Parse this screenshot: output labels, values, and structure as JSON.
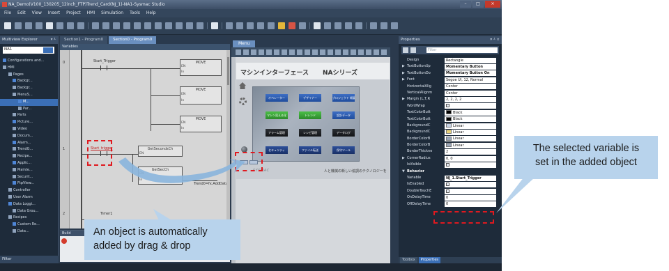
{
  "window": {
    "title": "NA_Demo(V100_130205_12inch_FTP)Trend_Card(NJ_1)-NA1-Sysmac Studio"
  },
  "menubar": [
    "File",
    "Edit",
    "View",
    "Insert",
    "Project",
    "HMI",
    "Simulation",
    "Tools",
    "Help"
  ],
  "explorer": {
    "title": "Multiview Explorer",
    "device": "NA1",
    "items": [
      {
        "label": "Configurations and...",
        "sel": false
      },
      {
        "label": "HMI",
        "sel": false
      },
      {
        "label": "Pages",
        "sel": false
      },
      {
        "label": "Backgr...",
        "sel": false
      },
      {
        "label": "Backgr...",
        "sel": false
      },
      {
        "label": "MenuS...",
        "sel": false
      },
      {
        "label": "M...",
        "sel": true
      },
      {
        "label": "Par...",
        "sel": false
      },
      {
        "label": "Parts",
        "sel": false
      },
      {
        "label": "Picture...",
        "sel": false
      },
      {
        "label": "Video",
        "sel": false
      },
      {
        "label": "Docum...",
        "sel": false
      },
      {
        "label": "Alarm...",
        "sel": false
      },
      {
        "label": "TrendG...",
        "sel": false
      },
      {
        "label": "Recipe...",
        "sel": false
      },
      {
        "label": "Applic...",
        "sel": false
      },
      {
        "label": "Mainte...",
        "sel": false
      },
      {
        "label": "Securit...",
        "sel": false
      },
      {
        "label": "FtpView...",
        "sel": false
      },
      {
        "label": "Controller",
        "sel": false
      },
      {
        "label": "User Alarm",
        "sel": false
      },
      {
        "label": "Data Loggi...",
        "sel": false
      },
      {
        "label": "Data Grou...",
        "sel": false
      },
      {
        "label": "Recipes",
        "sel": false
      },
      {
        "label": "Custom Re...",
        "sel": false
      },
      {
        "label": "Data...",
        "sel": false
      }
    ],
    "filter_label": "Filter"
  },
  "editor": {
    "tabs": [
      "Section1 - Program0",
      "Section0 - Program0"
    ],
    "variables_bar": "Variables",
    "rung_numbers": [
      "0",
      "1",
      "2"
    ],
    "vars": {
      "start_trigger": "Start_Trigger",
      "start_trigger_added": "Start_trigger",
      "timer": "Timer1"
    },
    "blocks": {
      "move": "MOVE",
      "getsecond": "GetSecondsCh",
      "getsec": "GetSecCh",
      "trend": "Trend0=fx.AddData"
    },
    "pins": {
      "en": "EN",
      "eno": "ENO",
      "in": "In",
      "out": "Out"
    },
    "build_title": "Build"
  },
  "menu_pane": {
    "tab": "Menu",
    "screen_title_left": "マシンインターフェース",
    "screen_title_right": "NAシリーズ",
    "buttons": [
      {
        "label": "オペレーター",
        "style": "blue"
      },
      {
        "label": "デザイナー",
        "style": "blue"
      },
      {
        "label": "プロジェクト 概要",
        "style": "blue"
      },
      {
        "label": "マシン見える化",
        "style": "green"
      },
      {
        "label": "トレンド",
        "style": "green"
      },
      {
        "label": "設計データ",
        "style": "blue"
      },
      {
        "label": "アラーム管理",
        "style": "dark"
      },
      {
        "label": "レシピ管理",
        "style": "dark"
      },
      {
        "label": "データログ",
        "style": "dark"
      },
      {
        "label": "セキュリティ",
        "style": "dblue"
      },
      {
        "label": "ファイル転送",
        "style": "dblue"
      },
      {
        "label": "保守ツール",
        "style": "dblue"
      }
    ],
    "logo": "SYSMAC",
    "footer": "人と機械の新しい協調のテクノロジーを"
  },
  "properties": {
    "title": "Properties",
    "filter_placeholder": "Filter",
    "rows": [
      {
        "name": "Design",
        "value": "Rectangle",
        "arrow": false
      },
      {
        "name": "TextButtonUp",
        "value": "Momentary Button",
        "arrow": true,
        "bold": true
      },
      {
        "name": "TextButtonDo",
        "value": "Momentary Button On",
        "arrow": true,
        "bold": true
      },
      {
        "name": "Font",
        "value": "Segoe UI, 12, Normal",
        "arrow": true
      },
      {
        "name": "HorizontalAlig",
        "value": "Center",
        "arrow": false
      },
      {
        "name": "VerticalAlignm",
        "value": "Center",
        "arrow": false
      },
      {
        "name": "Margin (L,T,R",
        "value": "2, 2, 2, 2",
        "arrow": true
      },
      {
        "name": "WordWrap",
        "value": "",
        "arrow": false,
        "check": true
      },
      {
        "name": "TextColorButt",
        "value": "Black",
        "arrow": false,
        "swatch": "#000000"
      },
      {
        "name": "TextColorButt",
        "value": "Black",
        "arrow": false,
        "swatch": "#000000"
      },
      {
        "name": "BackgroundC",
        "value": "Linear",
        "arrow": false,
        "swatch": "#c8d4e6"
      },
      {
        "name": "BackgroundC",
        "value": "Linear",
        "arrow": false,
        "swatch": "#e8d27a"
      },
      {
        "name": "BorderColorB",
        "value": "Linear",
        "arrow": false,
        "swatch": "#9aa6b8"
      },
      {
        "name": "BorderColorB",
        "value": "Linear",
        "arrow": false,
        "swatch": "#9aa6b8"
      },
      {
        "name": "BorderThickne",
        "value": "2",
        "arrow": false
      },
      {
        "name": "CornerRadius",
        "value": "0, 0",
        "arrow": true
      },
      {
        "name": "IsVisible",
        "value": "",
        "arrow": false,
        "check": true
      },
      {
        "name": "Behavior",
        "value": "",
        "header": true
      },
      {
        "name": "Variable",
        "value": "NJ_1.Start_Trigger",
        "arrow": false,
        "bold": true
      },
      {
        "name": "IsEnabled",
        "value": "",
        "arrow": false,
        "check": true
      },
      {
        "name": "DoubleTouchE",
        "value": "",
        "arrow": false,
        "check": true
      },
      {
        "name": "OnDelayTime",
        "value": "0",
        "arrow": false
      },
      {
        "name": "OffDelayTime",
        "value": "0",
        "arrow": false
      }
    ],
    "tabs": [
      "Toolbox",
      "Properties"
    ]
  },
  "annotations": {
    "left_callout": [
      "An object is automatically",
      "added by drag & drop"
    ],
    "right_callout": [
      "The selected variable is",
      "set in the added object"
    ]
  },
  "colors": {
    "dash": "#e0191f",
    "callout_bg": "#b8d3ec",
    "arrow": "#8ab5dd"
  }
}
